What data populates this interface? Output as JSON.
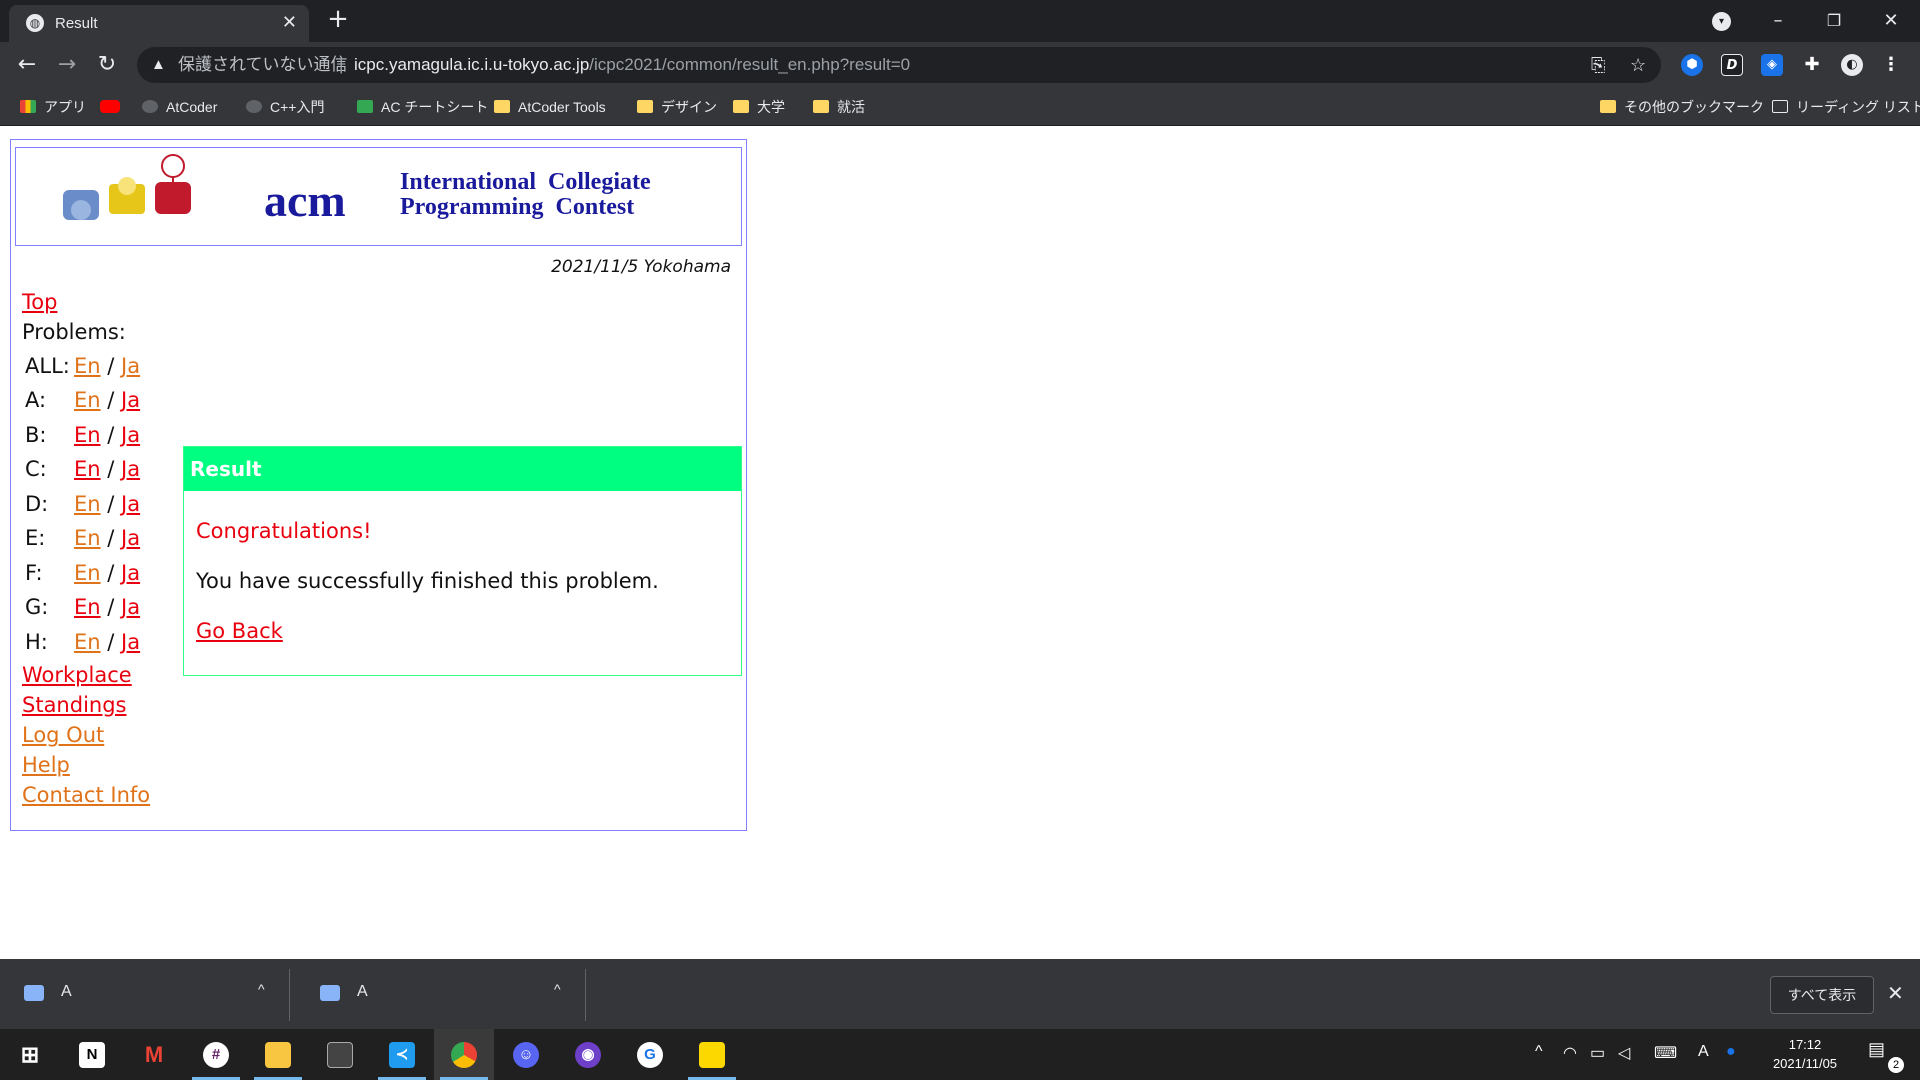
{
  "tab": {
    "title": "Result",
    "close_glyph": "✕",
    "new_tab_glyph": "+"
  },
  "window": {
    "minimize": "–",
    "restore": "❐",
    "close": "✕"
  },
  "toolbar": {
    "back": "←",
    "forward": "→",
    "reload": "↻",
    "security_text": "保護されていない通信",
    "url_host": "icpc.yamagula.ic.i.u-tokyo.ac.jp",
    "url_path": "/icpc2021/common/result_en.php?result=0"
  },
  "bookmarks": {
    "items": [
      "アプリ",
      "",
      "AtCoder",
      "C++入門",
      "AC チートシート",
      "AtCoder Tools",
      "デザイン",
      "大学",
      "就活"
    ],
    "other": "その他のブックマーク",
    "reading_list": "リーディング リスト"
  },
  "page": {
    "banner": {
      "acm": "acm",
      "title_line1": "International Collegiate",
      "title_line2": "Programming Contest"
    },
    "dateline": "2021/11/5 Yokohama",
    "nav": {
      "top": "Top",
      "problems_label": "Problems:",
      "rows": [
        {
          "label": "ALL:",
          "en": "En",
          "ja": "Ja"
        },
        {
          "label": "A:",
          "en": "En",
          "ja": "Ja"
        },
        {
          "label": "B:",
          "en": "En",
          "ja": "Ja"
        },
        {
          "label": "C:",
          "en": "En",
          "ja": "Ja"
        },
        {
          "label": "D:",
          "en": "En",
          "ja": "Ja"
        },
        {
          "label": "E:",
          "en": "En",
          "ja": "Ja"
        },
        {
          "label": "F:",
          "en": "En",
          "ja": "Ja"
        },
        {
          "label": "G:",
          "en": "En",
          "ja": "Ja"
        },
        {
          "label": "H:",
          "en": "En",
          "ja": "Ja"
        }
      ],
      "slash": "/",
      "workplace": "Workplace",
      "standings": "Standings",
      "logout": "Log Out",
      "help": "Help",
      "contact": "Contact Info"
    },
    "result": {
      "heading": "Result",
      "congrats": "Congratulations!",
      "message": "You have successfully finished this problem.",
      "go_back": "Go Back"
    }
  },
  "downloads": {
    "items": [
      {
        "name": "A"
      },
      {
        "name": "A"
      }
    ],
    "caret": "^",
    "show_all": "すべて表示",
    "close": "✕"
  },
  "taskbar": {
    "clock_time": "17:12",
    "clock_date": "2021/11/05",
    "ime": "A",
    "notification_count": "2"
  },
  "colors": {
    "link": "#e8000e",
    "visited_link": "#e0731a",
    "result_header": "#00ff80",
    "frame_border": "#7f7fff"
  }
}
